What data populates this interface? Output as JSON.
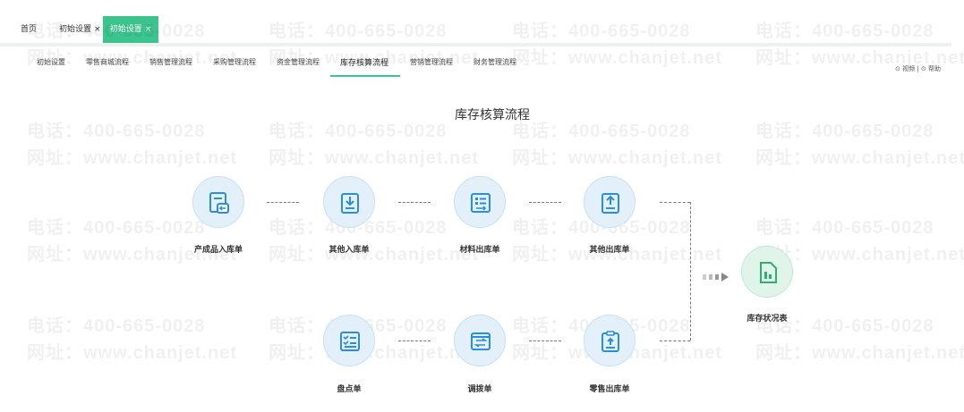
{
  "tabs": [
    {
      "label": "首页",
      "close": ""
    },
    {
      "label": "初始设置",
      "close": "×"
    },
    {
      "label": "初始设置",
      "close": "×"
    }
  ],
  "nav": [
    "初始设置",
    "零售商城流程",
    "销售管理流程",
    "采购管理流程",
    "资金管理流程",
    "库存核算流程",
    "营销管理流程",
    "财务管理流程"
  ],
  "help": {
    "video": "⊙ 视频",
    "divider": "|",
    "help": "⊙ 帮助"
  },
  "title": "库存核算流程",
  "nodes": {
    "product_in": "产成品入库单",
    "other_in": "其他入库单",
    "material_out": "材料出库单",
    "other_out": "其他出库单",
    "stock_report": "库存状况表",
    "inventory_check": "盘点单",
    "transfer": "调拨单",
    "retail_out": "零售出库单"
  },
  "watermark": {
    "phone": "电话：400-665-0028",
    "site": "网址：www.chanjet.net"
  },
  "colors": {
    "accent": "#3bc48d",
    "icon_blue": "#2a8fd6",
    "icon_green": "#2fae6e"
  },
  "icons": {
    "product_in": "document-return-icon",
    "other_in": "download-doc-icon",
    "material_out": "list-out-icon",
    "other_out": "upload-doc-icon",
    "stock_report": "chart-report-icon",
    "inventory_check": "checklist-icon",
    "transfer": "transfer-icon",
    "retail_out": "clipboard-upload-icon"
  }
}
